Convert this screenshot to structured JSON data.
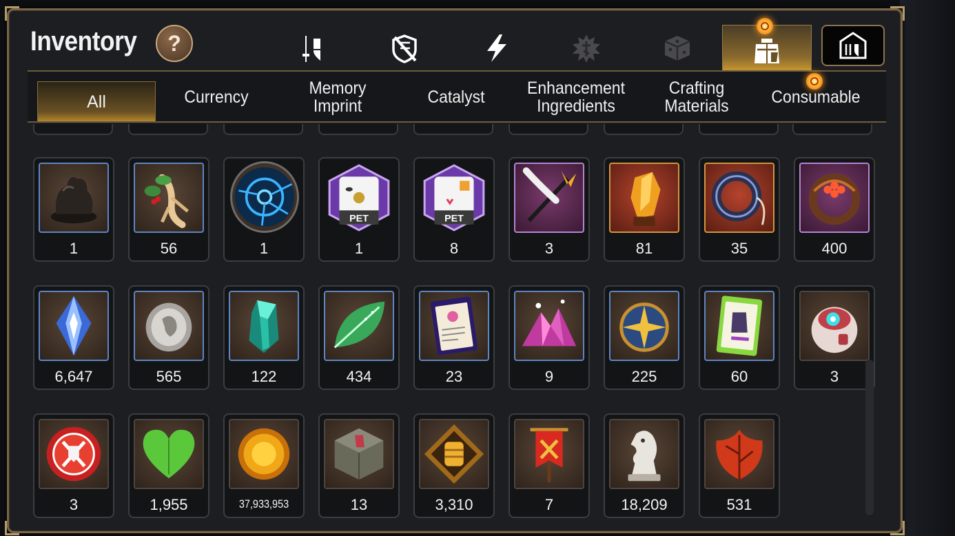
{
  "header": {
    "title": "Inventory",
    "help_label": "?"
  },
  "category_icons": [
    {
      "name": "equipment-icon"
    },
    {
      "name": "shield-off-icon"
    },
    {
      "name": "lightning-icon"
    },
    {
      "name": "rune-icon"
    },
    {
      "name": "cube-icon"
    },
    {
      "name": "bag-icon",
      "active": true
    },
    {
      "name": "guild-storage-icon"
    }
  ],
  "subtabs": [
    {
      "label": "All",
      "active": true
    },
    {
      "label": "Currency"
    },
    {
      "label": "Memory\nImprint"
    },
    {
      "label": "Catalyst"
    },
    {
      "label": "Enhancement\nIngredients"
    },
    {
      "label": "Crafting\nMaterials"
    },
    {
      "label": "Consumable",
      "badge": true
    }
  ],
  "items": [
    {
      "name": "tar-lump",
      "count": "1",
      "frame": "blue"
    },
    {
      "name": "ginseng-root",
      "count": "56",
      "frame": "blue"
    },
    {
      "name": "blue-rune-orb",
      "count": "1",
      "frame": "circle"
    },
    {
      "name": "pet-bag-spotted",
      "count": "1",
      "frame": "pet"
    },
    {
      "name": "pet-bag",
      "count": "8",
      "frame": "pet"
    },
    {
      "name": "feather-wand",
      "count": "3",
      "frame": "purple"
    },
    {
      "name": "amber-crystal",
      "count": "81",
      "frame": "orange"
    },
    {
      "name": "lasso-ring",
      "count": "35",
      "frame": "orange"
    },
    {
      "name": "flower-ring",
      "count": "400",
      "frame": "purple"
    },
    {
      "name": "blue-gem",
      "count": "6,647",
      "frame": "blue"
    },
    {
      "name": "silver-coin",
      "count": "565",
      "frame": "blue"
    },
    {
      "name": "teal-crystal",
      "count": "122",
      "frame": "blue"
    },
    {
      "name": "green-leaf",
      "count": "434",
      "frame": "blue"
    },
    {
      "name": "pet-card",
      "count": "23",
      "frame": "blue"
    },
    {
      "name": "pink-crystal-pile",
      "count": "9",
      "frame": "blue"
    },
    {
      "name": "star-amulet",
      "count": "225",
      "frame": "blue"
    },
    {
      "name": "costume-card",
      "count": "60",
      "frame": "blue"
    },
    {
      "name": "robot-orb",
      "count": "3",
      "frame": "brown"
    },
    {
      "name": "red-seal-badge",
      "count": "3",
      "frame": "brown"
    },
    {
      "name": "green-heart",
      "count": "1,955",
      "frame": "brown"
    },
    {
      "name": "gold-coin",
      "count": "37,933,953",
      "frame": "brown",
      "small": true
    },
    {
      "name": "stone-cube",
      "count": "13",
      "frame": "brown"
    },
    {
      "name": "fist-emblem",
      "count": "3,310",
      "frame": "brown"
    },
    {
      "name": "war-banner",
      "count": "7",
      "frame": "brown"
    },
    {
      "name": "knight-chess-piece",
      "count": "18,209",
      "frame": "brown"
    },
    {
      "name": "red-leaf",
      "count": "531",
      "frame": "brown"
    }
  ],
  "colors": {
    "accent_gold": "#c89830",
    "frame_border": "#7a6548",
    "blue_frame": "#5d86c4",
    "orange_frame": "#d3953e",
    "purple_frame": "#b784d5"
  }
}
